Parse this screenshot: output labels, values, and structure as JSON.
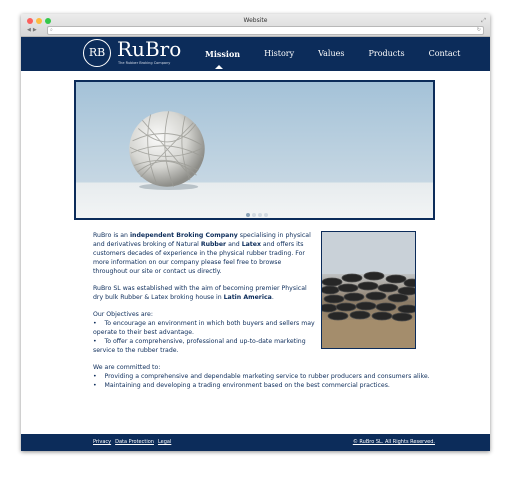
{
  "window": {
    "title": "Website"
  },
  "brand": {
    "logo_letters": "RB",
    "name": "RuBro",
    "tagline": "The Rubber Broking Company"
  },
  "nav": {
    "items": [
      "Mission",
      "History",
      "Values",
      "Products",
      "Contact"
    ],
    "active": "Mission"
  },
  "intro": {
    "p1": [
      {
        "t": "RuBro is an "
      },
      {
        "t": "independent Broking Company",
        "b": true
      },
      {
        "t": " specialising in physical and derivatives broking of Natural "
      },
      {
        "t": "Rubber",
        "b": true
      },
      {
        "t": " and "
      },
      {
        "t": "Latex",
        "b": true
      },
      {
        "t": " and offers its customers decades of experience in the physical rubber trading. For more information on our company please feel free to browse throughout our site or contact us directly."
      }
    ],
    "p2": [
      {
        "t": "RuBro SL was established with the aim of becoming premier Physical dry bulk Rubber & Latex broking house in "
      },
      {
        "t": "Latin America",
        "b": true
      },
      {
        "t": "."
      }
    ]
  },
  "objectives": {
    "heading": "Our Objectives are:",
    "items": [
      "To encourage an environment in which both buyers and sellers may operate to their best advantage.",
      "To offer a comprehensive, professional and up-to-date marketing service to the rubber trade."
    ]
  },
  "committed": {
    "heading": "We are committed to:",
    "items": [
      "Providing a comprehensive and dependable marketing service to rubber producers and consumers alike.",
      "Maintaining and developing a trading environment based on the best commercial practices."
    ]
  },
  "footer": {
    "links": [
      "Privacy",
      "Data Protection",
      "Legal"
    ],
    "copyright": "© RuBro SL. All Rights Reserved."
  },
  "colors": {
    "navy": "#0c2c5a",
    "sky": "#a4c2d8"
  },
  "icons": [
    "close-light-icon",
    "minimize-light-icon",
    "zoom-light-icon",
    "back-icon",
    "forward-icon",
    "search-icon",
    "reload-icon",
    "resize-icon"
  ]
}
